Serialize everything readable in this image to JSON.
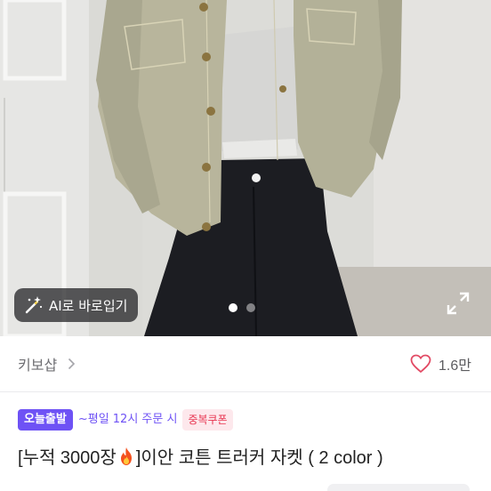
{
  "photo": {
    "ai_button_label": "AI로 바로입기",
    "carousel_total": 2,
    "carousel_active": 1
  },
  "shop": {
    "name": "키보샵",
    "like_count": "1.6만"
  },
  "badges": {
    "delivery": "오늘출발",
    "cutoff": "~평일 12시 주문 시",
    "coupon": "중복쿠폰"
  },
  "product": {
    "title_prefix": "[누적 3000장",
    "title_suffix": "]이안 코튼 트러커 자켓 ( 2 color )"
  },
  "colors": {
    "accent": "#6e52f5",
    "coupon": "#e8334f"
  }
}
